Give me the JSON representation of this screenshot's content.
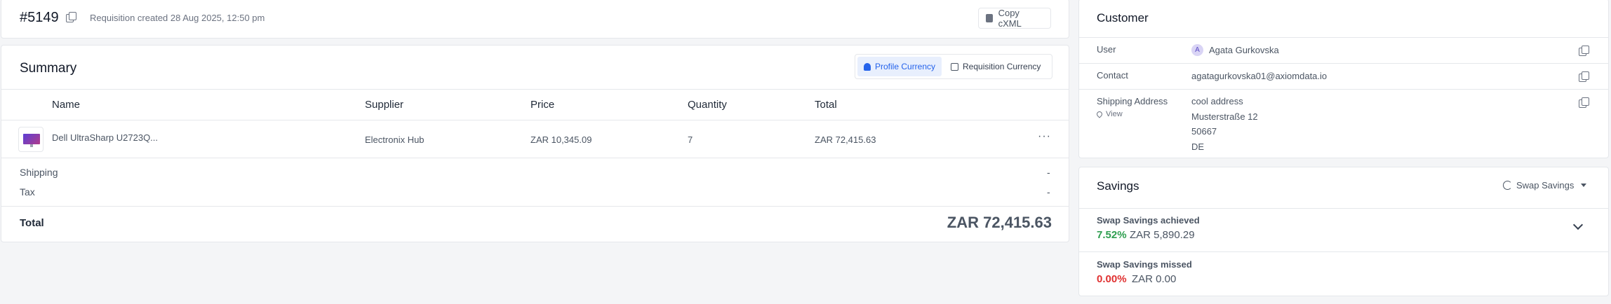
{
  "header": {
    "req_number": "#5149",
    "created_text": "Requisition created 28 Aug 2025, 12:50 pm",
    "copy_cxml_label": "Copy cXML"
  },
  "summary": {
    "title": "Summary",
    "currency_toggle": {
      "profile_label": "Profile Currency",
      "requisition_label": "Requisition Currency",
      "active": "profile"
    },
    "columns": [
      "Name",
      "Supplier",
      "Price",
      "Quantity",
      "Total"
    ],
    "items": [
      {
        "name": "Dell UltraSharp U2723Q...",
        "supplier": "Electronix Hub",
        "price": "ZAR 10,345.09",
        "quantity": "7",
        "total": "ZAR 72,415.63"
      }
    ],
    "shipping_label": "Shipping",
    "shipping_value": "-",
    "tax_label": "Tax",
    "tax_value": "-",
    "total_label": "Total",
    "total_value": "ZAR 72,415.63"
  },
  "customer": {
    "title": "Customer",
    "user_label": "User",
    "user_initial": "A",
    "user_name": "Agata Gurkovska",
    "contact_label": "Contact",
    "contact_email": "agatagurkovska01@axiomdata.io",
    "shipping_label": "Shipping Address",
    "view_label": "View",
    "address_lines": [
      "cool address",
      "Musterstraße 12",
      "50667",
      "DE"
    ]
  },
  "savings": {
    "title": "Savings",
    "dropdown_label": "Swap Savings",
    "achieved_label": "Swap Savings achieved",
    "achieved_percent": "7.52%",
    "achieved_amount": "ZAR 5,890.29",
    "missed_label": "Swap Savings missed",
    "missed_percent": "0.00%",
    "missed_amount": "ZAR 0.00",
    "colors": {
      "positive": "#2e9e4f",
      "negative": "#e03131",
      "accent": "#2563eb"
    }
  }
}
